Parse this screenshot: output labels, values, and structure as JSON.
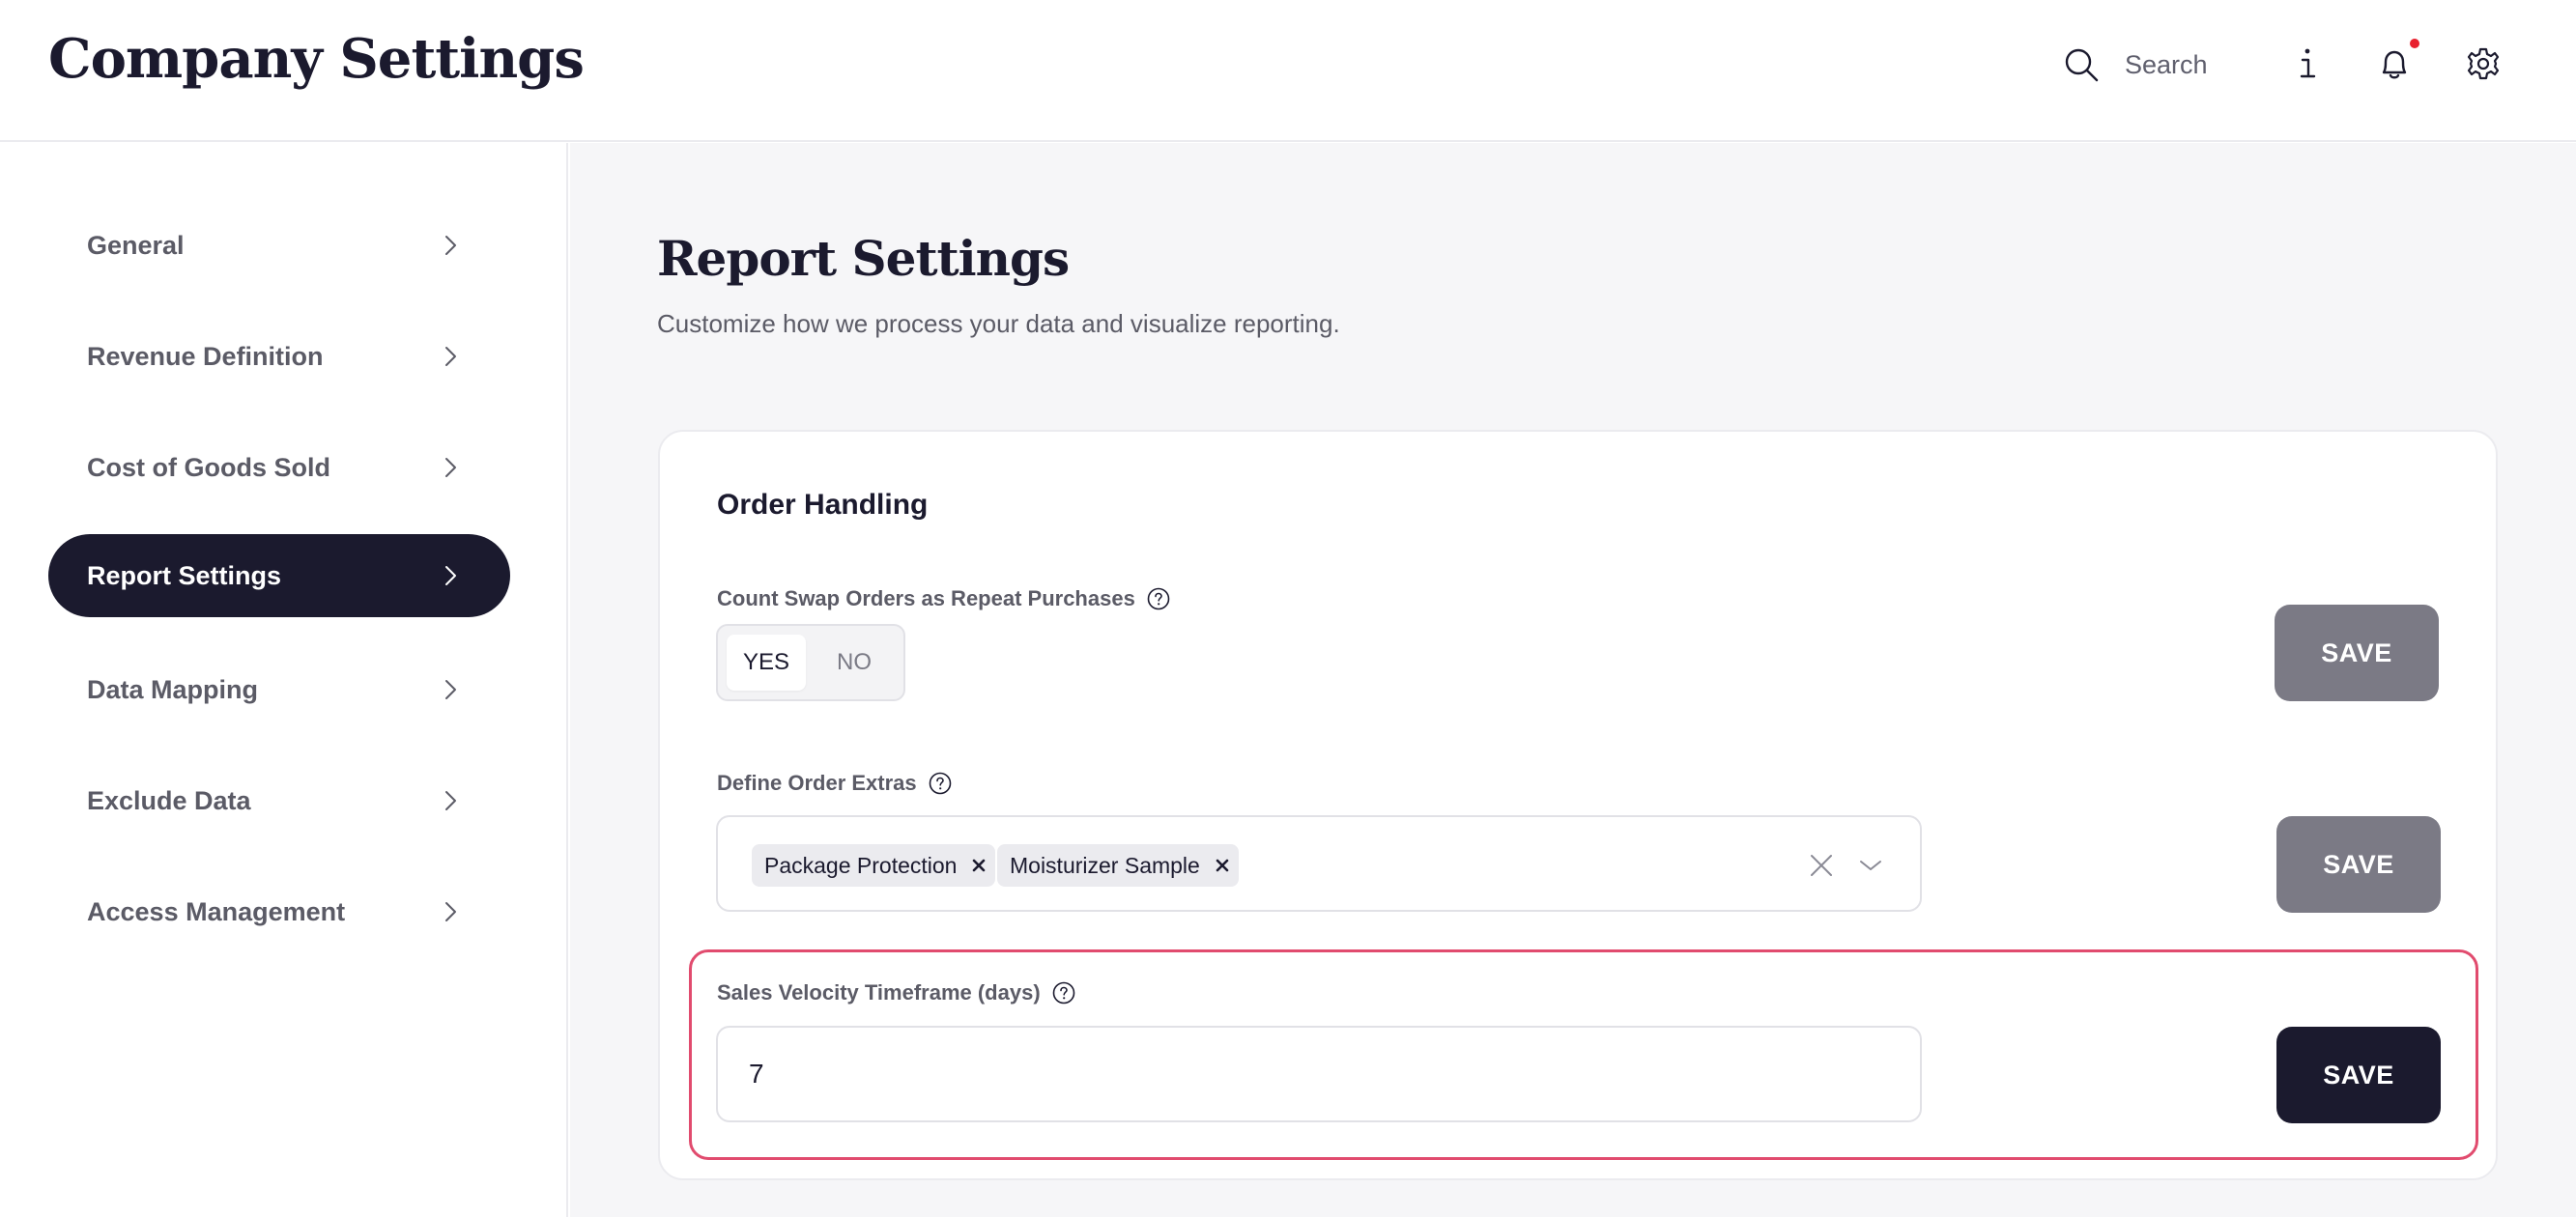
{
  "header": {
    "title": "Company Settings",
    "search_placeholder": "Search",
    "icons": [
      "search-icon",
      "info-icon",
      "bell-icon",
      "gear-icon"
    ],
    "has_notification": true
  },
  "sidebar": {
    "items": [
      {
        "label": "General",
        "active": false
      },
      {
        "label": "Revenue Definition",
        "active": false
      },
      {
        "label": "Cost of Goods Sold",
        "active": false
      },
      {
        "label": "Report Settings",
        "active": true
      },
      {
        "label": "Data Mapping",
        "active": false
      },
      {
        "label": "Exclude Data",
        "active": false
      },
      {
        "label": "Access Management",
        "active": false
      }
    ]
  },
  "main": {
    "title": "Report Settings",
    "subtitle": "Customize how we process your data and visualize reporting.",
    "card": {
      "title": "Order Handling",
      "swap_orders": {
        "label": "Count Swap Orders as Repeat Purchases",
        "yes": "YES",
        "no": "NO",
        "selected": "YES",
        "save": "SAVE"
      },
      "order_extras": {
        "label": "Define Order Extras",
        "chips": [
          "Package Protection",
          "Moisturizer Sample"
        ],
        "save": "SAVE"
      },
      "sales_velocity": {
        "label": "Sales Velocity Timeframe (days)",
        "value": "7",
        "save": "SAVE"
      }
    }
  },
  "colors": {
    "primary": "#1b1a2e",
    "disabled_button": "#7b7a85",
    "highlight_border": "#e14b6e",
    "notification_dot": "#e8202e",
    "main_background": "#f6f6f8"
  }
}
